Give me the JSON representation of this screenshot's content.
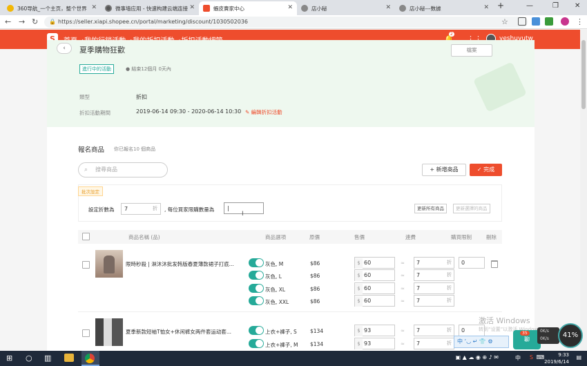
{
  "browser": {
    "tabs": [
      {
        "label": "360导航_一个主页，整个世界",
        "icon_color": "#f2b705",
        "active": false
      },
      {
        "label": "微事墙应用 - 快速构建云端连接",
        "icon_color": "#555555",
        "active": false
      },
      {
        "label": "蝦皮賣家中心",
        "icon_color": "#ee4d2d",
        "active": true
      },
      {
        "label": "店小秘",
        "icon_color": "#888888",
        "active": false
      },
      {
        "label": "店小秘---数據",
        "icon_color": "#888888",
        "active": false
      }
    ],
    "new_tab": "+",
    "window_controls": {
      "minimize": "—",
      "maximize": "❐",
      "close": "✕"
    },
    "url": "https://seller.xiapi.shopee.cn/portal/marketing/discount/1030502036"
  },
  "header": {
    "logo": "S",
    "breadcrumbs": [
      "首頁",
      "›我的行銷活動",
      "›我的折扣活動",
      "›折扣活動細節"
    ],
    "notification_count": "2",
    "username": "yeshuyutw"
  },
  "campaign": {
    "title": "夏季購物狂歡",
    "back": "‹",
    "top_button": "檔案",
    "status": "進行中的活動",
    "remaining": "● 結束12個月 0天內",
    "type_label": "類型",
    "type_value": "折扣",
    "period_label": "折扣活動期間",
    "period_value": "2019-06-14 09:30 - 2020-06-14 10:30",
    "edit_link": "編輯折扣活動"
  },
  "products": {
    "title": "報名商品",
    "subtitle": "你已報名10 個商品",
    "search_placeholder": "搜尋商品",
    "add_button": "+ 新增商品",
    "done_button": "✓ 完成",
    "batch": {
      "tag": "批次設定",
      "discount_label": "設定折數為",
      "discount_value": "7",
      "discount_suffix": "折",
      "limit_label": ", 每位買家限購數量為",
      "limit_value": "|",
      "update_all": "更新所有商品",
      "update_selected": "更新選擇的商品"
    },
    "columns": [
      "商品名稱 (品)",
      "商品選項",
      "原價",
      "售價",
      "連費",
      "購買限制",
      "刪除"
    ],
    "items": [
      {
        "name": "限時秒殺 | 淋沐沐批发韩版春夏薄款裙子打底...",
        "variants": [
          {
            "option": "灰色, M",
            "orig": "$86",
            "currency": "$",
            "price": "60",
            "approx": "≈",
            "discount": "7",
            "unit": "折",
            "limit": "0"
          },
          {
            "option": "灰色, L",
            "orig": "$86",
            "currency": "$",
            "price": "60",
            "approx": "≈",
            "discount": "7",
            "unit": "折"
          },
          {
            "option": "灰色, XL",
            "orig": "$86",
            "currency": "$",
            "price": "60",
            "approx": "≈",
            "discount": "7",
            "unit": "折"
          },
          {
            "option": "灰色, XXL",
            "orig": "$86",
            "currency": "$",
            "price": "60",
            "approx": "≈",
            "discount": "7",
            "unit": "折"
          }
        ]
      },
      {
        "name": "夏季新款短袖T恤女+休闲裤女两件套运动套...",
        "variants": [
          {
            "option": "上衣+褲子, S",
            "orig": "$134",
            "currency": "$",
            "price": "93",
            "approx": "≈",
            "discount": "7",
            "unit": "折",
            "limit": "0"
          },
          {
            "option": "上衣+褲子, M",
            "orig": "$134",
            "currency": "$",
            "price": "93",
            "approx": "≈",
            "discount": "7",
            "unit": "折"
          }
        ]
      }
    ]
  },
  "overlay": {
    "watermark": "激活 Windows",
    "watermark_sub": "转到“设置”以激活 Windows。",
    "ime": "中 ʼ◡ ↵ 👕 ⚙",
    "chat_badge": "35",
    "chat_label": "聊",
    "net_up": "0K/s",
    "net_down": "0K/s",
    "speed": "41%"
  },
  "taskbar": {
    "time": "9:33",
    "date": "2019/6/14",
    "ime_tray": "中",
    "notify": "2"
  }
}
